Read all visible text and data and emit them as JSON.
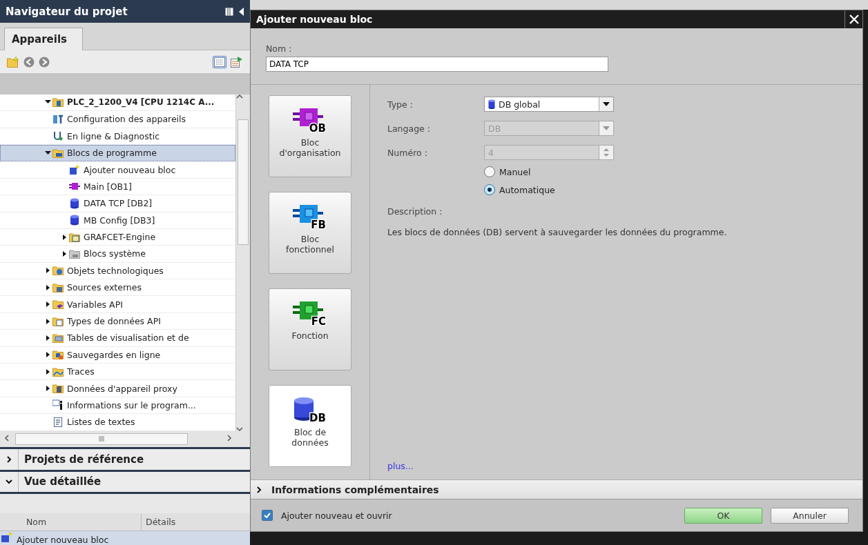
{
  "navigator": {
    "title": "Navigateur du projet",
    "tabs": [
      {
        "label": "Appareils",
        "selected": true
      }
    ],
    "tree": [
      {
        "label": "PLC_2_1200_V4 [CPU 1214C A...",
        "kind": "cpu",
        "expanded": true,
        "selected": false,
        "children": [
          {
            "label": "Configuration des appareils",
            "kind": "config",
            "selected": false
          },
          {
            "label": "En ligne & Diagnostic",
            "kind": "diag",
            "selected": false
          },
          {
            "label": "Blocs de programme",
            "kind": "program",
            "expanded": true,
            "selected": true,
            "children": [
              {
                "label": "Ajouter nouveau bloc",
                "kind": "add",
                "selected": false
              },
              {
                "label": "Main [OB1]",
                "kind": "ob",
                "selected": false
              },
              {
                "label": "DATA TCP [DB2]",
                "kind": "db",
                "selected": false
              },
              {
                "label": "MB Config [DB3]",
                "kind": "db",
                "selected": false
              },
              {
                "label": "GRAFCET-Engine",
                "kind": "grafcet",
                "expanded": false,
                "selected": false
              },
              {
                "label": "Blocs système",
                "kind": "system",
                "expanded": false,
                "selected": false
              }
            ]
          },
          {
            "label": "Objets technologiques",
            "kind": "techno",
            "expanded": false,
            "selected": false
          },
          {
            "label": "Sources externes",
            "kind": "sources",
            "expanded": false,
            "selected": false
          },
          {
            "label": "Variables API",
            "kind": "tags",
            "expanded": false,
            "selected": false
          },
          {
            "label": "Types de données API",
            "kind": "types",
            "expanded": false,
            "selected": false
          },
          {
            "label": "Tables de visualisation et de",
            "kind": "watch",
            "expanded": false,
            "selected": false
          },
          {
            "label": "Sauvegardes en ligne",
            "kind": "backup",
            "expanded": false,
            "selected": false
          },
          {
            "label": "Traces",
            "kind": "traces",
            "expanded": false,
            "selected": false
          },
          {
            "label": "Données d'appareil proxy",
            "kind": "proxy",
            "expanded": false,
            "selected": false
          },
          {
            "label": "Informations sur le program...",
            "kind": "info",
            "selected": false
          },
          {
            "label": "Listes de textes",
            "kind": "textlist",
            "selected": false
          }
        ]
      }
    ],
    "sections": [
      {
        "label": "Projets de référence",
        "expanded": false
      },
      {
        "label": "Vue détaillée",
        "expanded": true
      }
    ],
    "details_table": {
      "columns": [
        "Nom",
        "Détails"
      ],
      "rows": [
        {
          "name": "Ajouter nouveau bloc"
        }
      ]
    }
  },
  "dialog": {
    "title": "Ajouter nouveau bloc",
    "name_label": "Nom :",
    "name_value": "DATA TCP",
    "block_types": [
      {
        "kind": "ob",
        "code": "OB",
        "label": "Bloc d'organisation",
        "selected": false
      },
      {
        "kind": "fb",
        "code": "FB",
        "label": "Bloc fonctionnel",
        "selected": false
      },
      {
        "kind": "fc",
        "code": "FC",
        "label": "Fonction",
        "selected": false
      },
      {
        "kind": "db",
        "code": "DB",
        "label": "Bloc de données",
        "selected": true
      }
    ],
    "fields": [
      {
        "kind": "dropdown",
        "label": "Type :",
        "value": "DB global",
        "disabled": false
      },
      {
        "kind": "dropdown",
        "label": "Langage :",
        "value": "DB",
        "disabled": true
      },
      {
        "kind": "spinner",
        "label": "Numéro :",
        "value": "4",
        "disabled": true
      }
    ],
    "numbering": [
      {
        "label": "Manuel",
        "selected": false
      },
      {
        "label": "Automatique",
        "selected": true
      }
    ],
    "description_label": "Description :",
    "description": "Les blocs de données (DB) servent à sauvegarder les données du programme.",
    "more_link": "plus...",
    "extra_section": {
      "label": "Informations complémentaires",
      "expanded": false
    },
    "open_after_add": {
      "label": "Ajouter nouveau et ouvrir",
      "checked": true
    },
    "buttons": [
      {
        "label": "OK",
        "kind": "primary"
      },
      {
        "label": "Annuler",
        "kind": "secondary"
      }
    ]
  }
}
